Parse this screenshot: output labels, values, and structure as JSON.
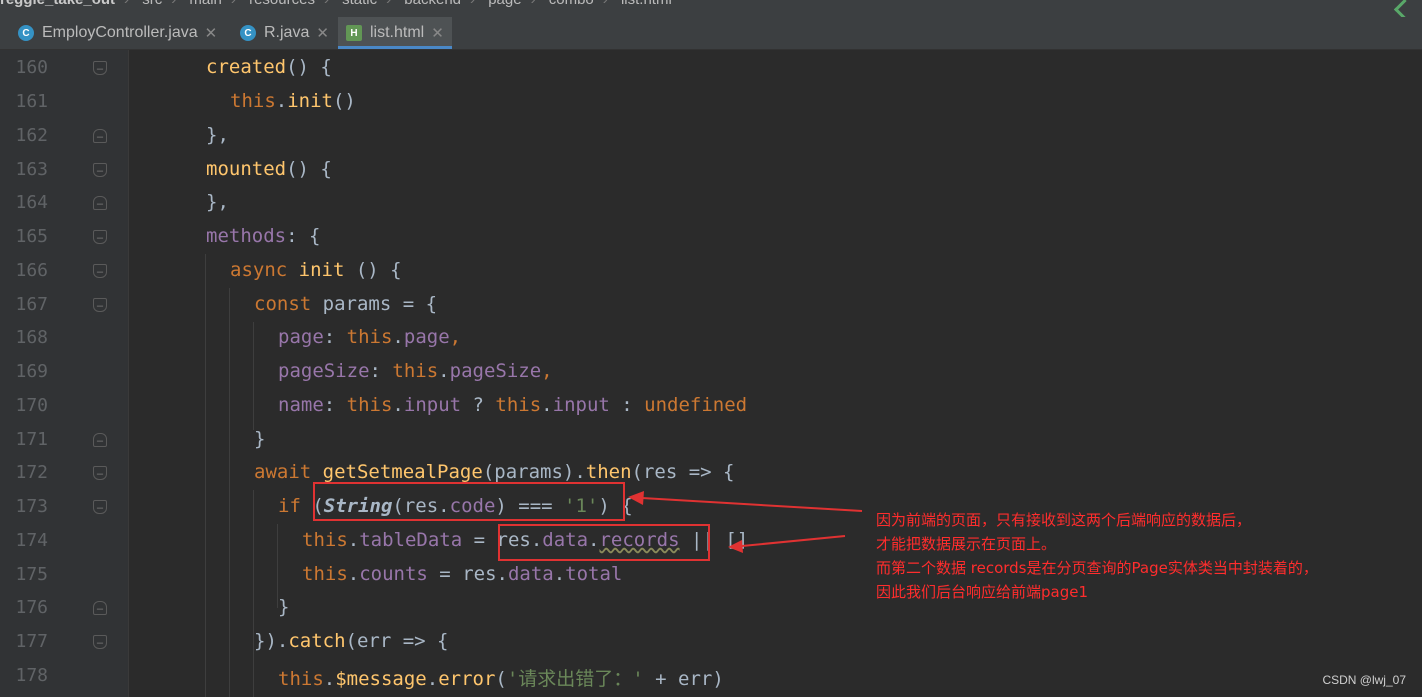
{
  "breadcrumbs": [
    "reggie_take_out",
    "src",
    "main",
    "resources",
    "static",
    "backend",
    "page",
    "combo",
    "list.html"
  ],
  "tabs": [
    {
      "icon": "C",
      "label": "EmployController.java",
      "active": false
    },
    {
      "icon": "C",
      "label": "R.java",
      "active": false
    },
    {
      "icon": "H",
      "label": "list.html",
      "active": true
    }
  ],
  "line_numbers": [
    "160",
    "161",
    "162",
    "163",
    "164",
    "165",
    "166",
    "167",
    "168",
    "169",
    "170",
    "171",
    "172",
    "173",
    "174",
    "175",
    "176",
    "177",
    "178"
  ],
  "code": {
    "l160": {
      "fn": "created",
      "rest": "() {"
    },
    "l161": {
      "this": "this",
      "dot": ".",
      "fn": "init",
      "rest": "()"
    },
    "l162": {
      "text": "},"
    },
    "l163": {
      "fn": "mounted",
      "rest": "() {"
    },
    "l164": {
      "text": "},"
    },
    "l165": {
      "prop": "methods",
      "rest": ": {"
    },
    "l166": {
      "kw": "async",
      "fn": "init",
      "rest": " () {"
    },
    "l167": {
      "kw": "const",
      "rest": " params = {"
    },
    "l168": {
      "prop": "page",
      "colon": ": ",
      "this": "this",
      "dot": ".",
      "prop2": "page",
      "comma": ","
    },
    "l169": {
      "prop": "pageSize",
      "colon": ": ",
      "this": "this",
      "dot": ".",
      "prop2": "pageSize",
      "comma": ","
    },
    "l170": {
      "prop": "name",
      "colon": ": ",
      "this": "this",
      "dot": ".",
      "prop2": "input",
      "q": " ? ",
      "this2": "this",
      "dot2": ".",
      "prop3": "input",
      "c": " : ",
      "kw": "undefined"
    },
    "l171": {
      "text": "}"
    },
    "l172": {
      "kw": "await",
      "fn": "getSetmealPage",
      "mid": "(params).",
      "fn2": "then",
      "rest": "(res => {"
    },
    "l173": {
      "kw": "if",
      "p1": " (",
      "cls": "String",
      "p2": "(res.",
      "prop": "code",
      "p3": ") === ",
      "str": "'1'",
      "p4": ") {"
    },
    "l174": {
      "this": "this",
      "dot": ".",
      "prop": "tableData",
      "eq": " = ",
      "a": "res.",
      "prop2": "data",
      "dot2": ".",
      "prop3": "records",
      "rest": " || []"
    },
    "l175": {
      "this": "this",
      "dot": ".",
      "prop": "counts",
      "eq": " = ",
      "a": "res.",
      "prop2": "data",
      "dot2": ".",
      "prop3": "total"
    },
    "l176": {
      "text": "}"
    },
    "l177": {
      "a": "}).",
      "fn": "catch",
      "rest": "(err => {"
    },
    "l178": {
      "this": "this",
      "dot": ".",
      "fn0": "$message",
      "dot2": ".",
      "fn": "error",
      "p": "(",
      "str": "'请求出错了：'",
      "rest": " + err)"
    }
  },
  "annotation": {
    "line1": "因为前端的页面，只有接收到这两个后端响应的数据后，",
    "line2": "才能把数据展示在页面上。",
    "line3": "而第二个数据 records是在分页查询的Page实体类当中封装着的，",
    "line4": "因此我们后台响应给前端page1"
  },
  "watermark": "CSDN @lwj_07",
  "colors": {
    "highlight": "#e03232",
    "annotation": "#ff2d2d",
    "keyword": "#cc7832",
    "function": "#ffc66d",
    "property": "#9876aa",
    "string": "#6a8759"
  }
}
